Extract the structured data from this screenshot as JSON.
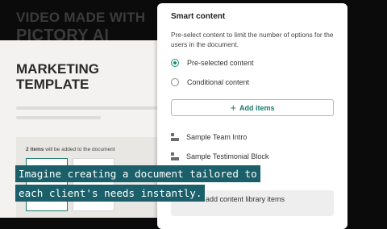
{
  "watermark": {
    "line1": "VIDEO MADE WITH",
    "line2": "PICTORY AI"
  },
  "document": {
    "title_line1": "MARKETING",
    "title_line2": "TEMPLATE",
    "selection_count": "2 items",
    "selection_text": " will be added to the document"
  },
  "panel": {
    "title": "Smart content",
    "description": "Pre-select content to limit the number of options for the users in the document.",
    "options": [
      {
        "label": "Pre-selected content",
        "selected": true
      },
      {
        "label": "Conditional content",
        "selected": false
      }
    ],
    "add_items_label": "Add items",
    "items": [
      {
        "label": "Sample Team Intro"
      },
      {
        "label": "Sample Testimonial Block"
      }
    ],
    "library_label": "add content library items"
  },
  "caption": {
    "line1": "Imagine creating a document tailored to",
    "line2": "each client's needs instantly."
  },
  "colors": {
    "accent": "#1a7a6b",
    "caption_bg": "#1a5f6a",
    "background": "#0b0b0b"
  }
}
